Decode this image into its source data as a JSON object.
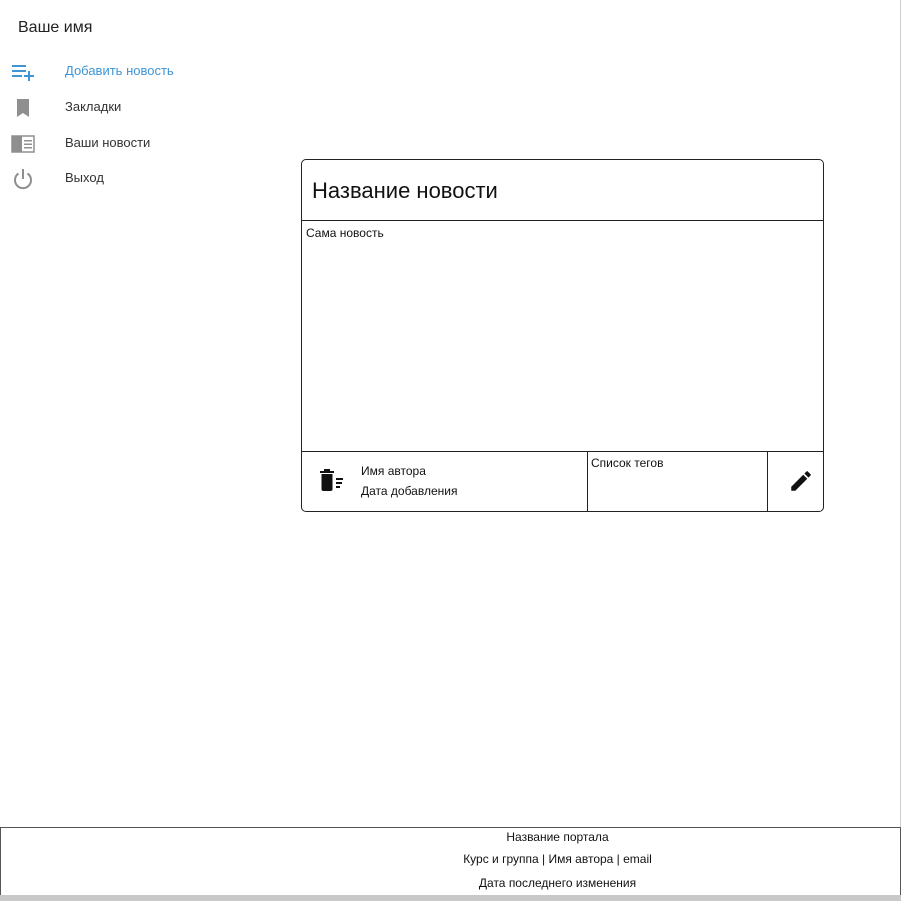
{
  "sidebar": {
    "user_name": "Ваше имя",
    "items": [
      {
        "label": "Добавить новость",
        "icon": "playlist-add-icon",
        "active": true
      },
      {
        "label": "Закладки",
        "icon": "bookmark-icon",
        "active": false
      },
      {
        "label": "Ваши новости",
        "icon": "newspaper-icon",
        "active": false
      },
      {
        "label": "Выход",
        "icon": "power-icon",
        "active": false
      }
    ]
  },
  "card": {
    "title": "Название новости",
    "body": "Сама новость",
    "author": "Имя автора",
    "date_added": "Дата добавления",
    "tags": "Список тегов",
    "delete_icon": "delete-sweep-icon",
    "edit_icon": "pencil-icon"
  },
  "footer": {
    "portal_name": "Название портала",
    "credits": "Курс и группа | Имя автора | email",
    "last_modified": "Дата последнего изменения"
  },
  "colors": {
    "accent": "#3d95d4",
    "icon_gray": "#8f8f8f",
    "border": "#222222"
  }
}
